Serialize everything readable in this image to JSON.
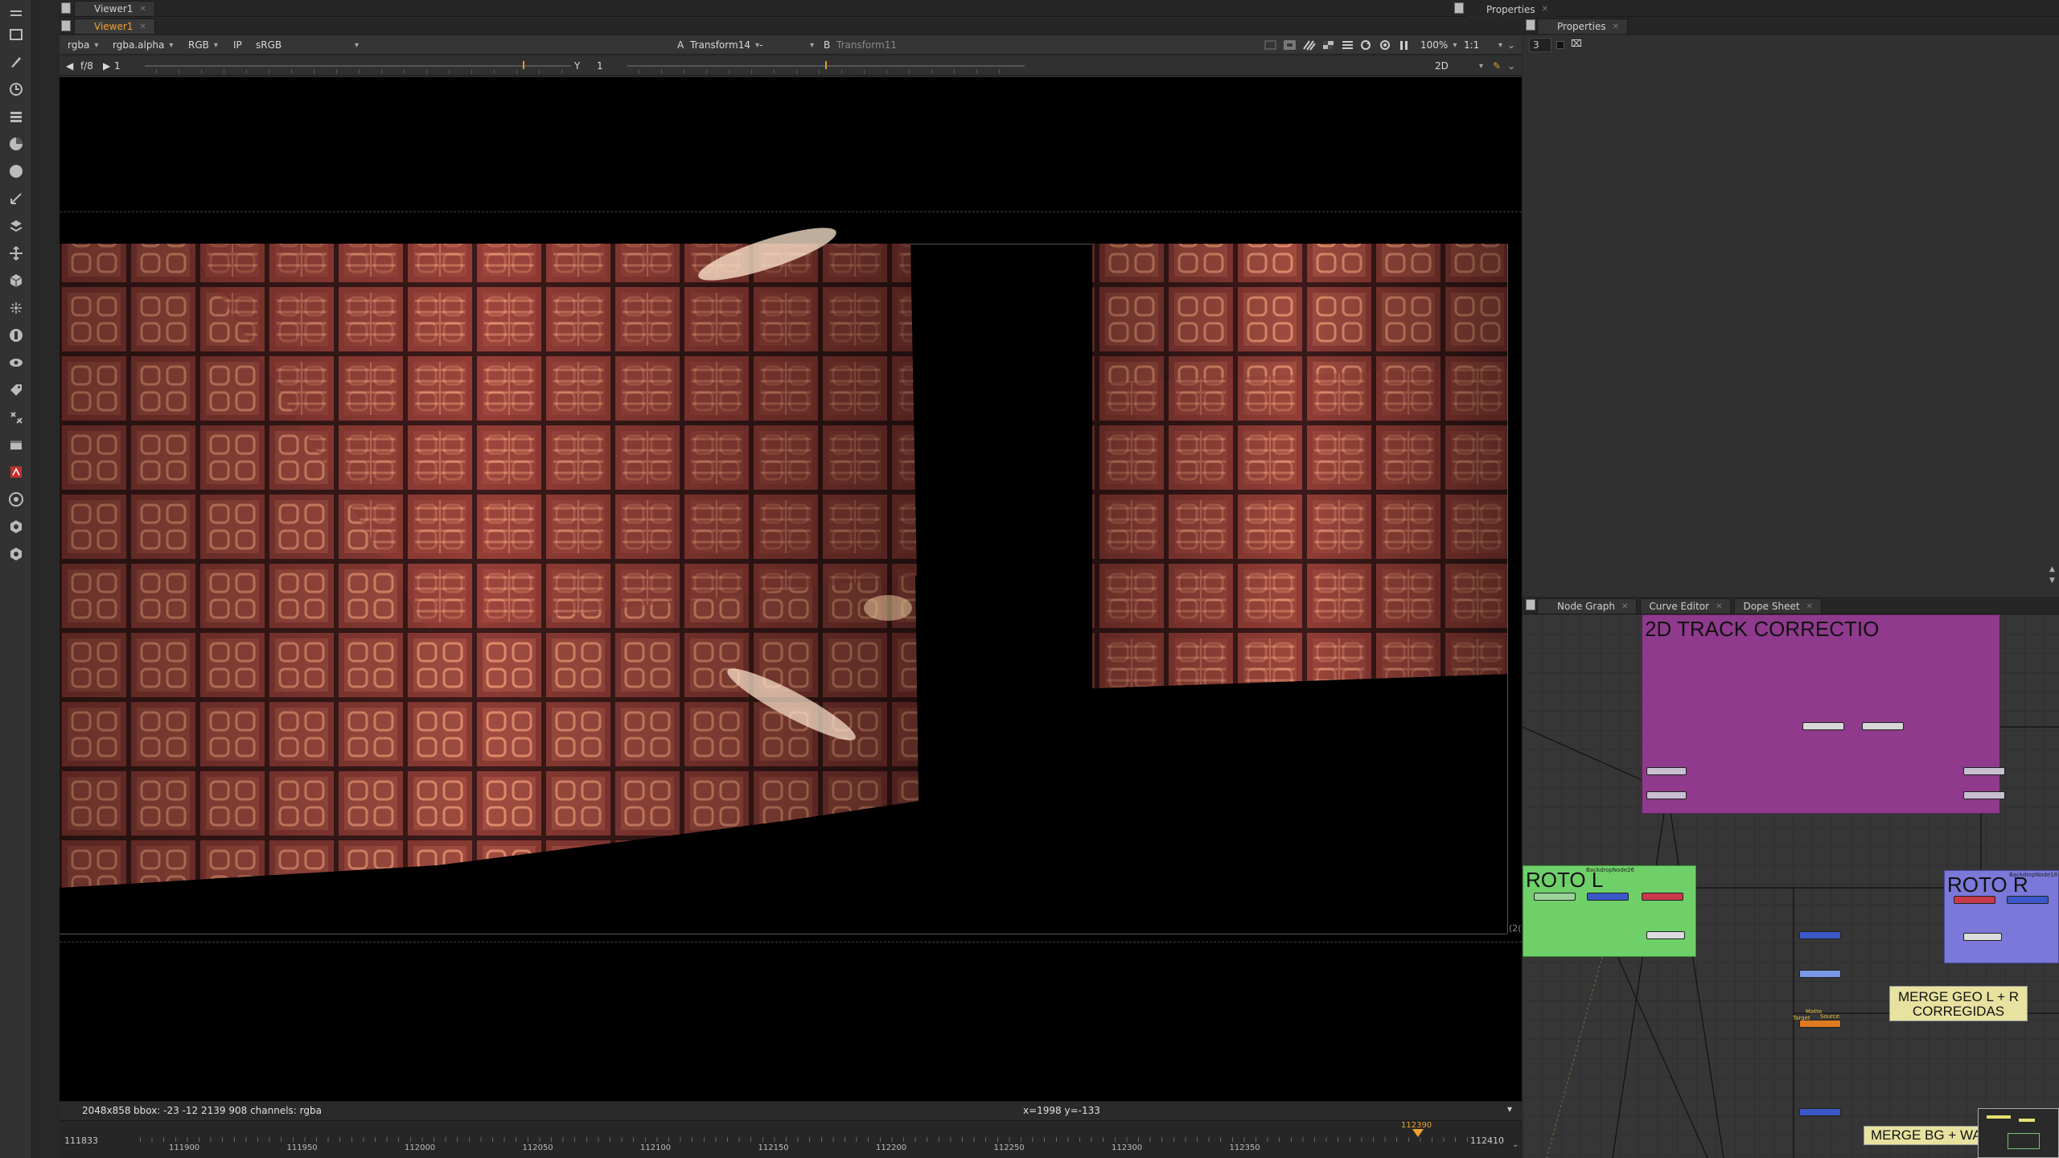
{
  "viewer_tabs_top": {
    "label": "Viewer1"
  },
  "viewer_tabs": {
    "label": "Viewer1"
  },
  "right_top": {
    "label": "Properties"
  },
  "properties": {
    "tab_label": "Properties",
    "max_panels": "3"
  },
  "viewer_controls": {
    "channels": "rgba",
    "alpha_channel": "rgba.alpha",
    "display_channels": "RGB",
    "ip": "IP",
    "lut": "sRGB",
    "input_a_label": "A",
    "input_a_value": "Transform14",
    "operation": "-",
    "input_b_label": "B",
    "input_b_value": "Transform11",
    "zoom": "100%",
    "proxy_scale": "1:1",
    "gain_label": "f/8",
    "gain_value": "1",
    "gamma_label": "Y",
    "gamma_value": "1",
    "view_mode": "2D"
  },
  "status": {
    "format": "2048x858",
    "bbox": "bbox: -23 -12 2139 908 channels: rgba",
    "coords": "x=1998 y=-133",
    "edge_label": "(2("
  },
  "timeline": {
    "start": "111833",
    "end": "112410",
    "current": "112390",
    "labels": [
      "111833",
      "111900",
      "111950",
      "112000",
      "112050",
      "112100",
      "112150",
      "112200",
      "112250",
      "112300",
      "112350",
      "112410"
    ]
  },
  "nodegraph": {
    "tabs": [
      "Node Graph",
      "Curve Editor",
      "Dope Sheet"
    ],
    "backdrop_track": "2D TRACK CORRECTIO",
    "backdrop_roto_l": "ROTO L",
    "backdrop_roto_r": "ROTO R",
    "backdrop_roto_l_small": "BackdropNode26",
    "backdrop_roto_r_small": "BackdropNode18",
    "sticky_merge_geo": "MERGE GEO L + R CORREGIDAS",
    "sticky_merge_bg": "MERGE BG + WALLS",
    "label_mask": "Matte",
    "label_a": "Source",
    "label_b": "Target"
  },
  "colors": {
    "accent": "#f0a030",
    "backdrop_track": "#8f3a8c",
    "backdrop_roto_l": "#6fd06a",
    "backdrop_roto_r": "#7a78d8",
    "sticky": "#e8e2a0"
  }
}
